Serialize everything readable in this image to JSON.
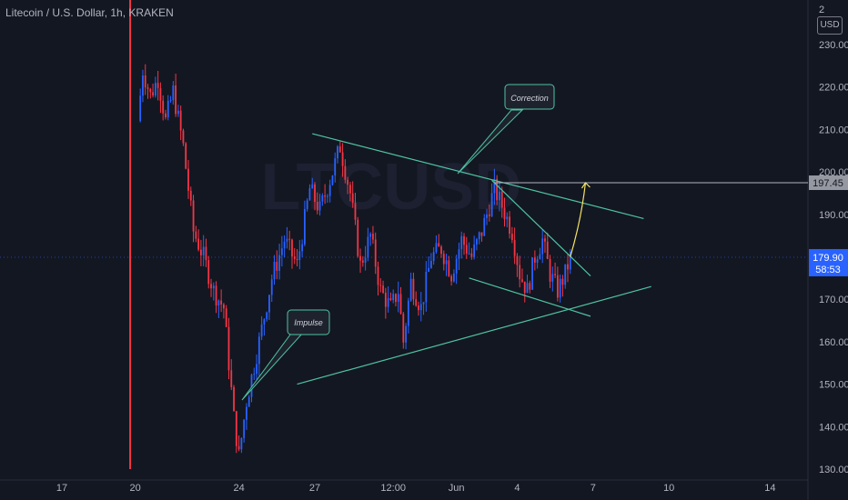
{
  "header": {
    "title": "Litecoin / U.S. Dollar, 1h, KRAKEN",
    "currency": "USD",
    "top_right_partial": "2"
  },
  "price_labels": {
    "target": "197.45",
    "current": "179.90",
    "countdown": "58:53"
  },
  "annotations": {
    "correction": "Correction",
    "impulse": "Impulse"
  },
  "colors": {
    "background": "#131722",
    "up": "#26a69a",
    "down": "#ef5350",
    "candle_blue": "#2962ff",
    "candle_red": "#f23645",
    "trendline": "#4fc3a1",
    "arrow": "#f7e463",
    "current_price_label": "#2962ff",
    "target_price_label": "#9598a1"
  },
  "chart_data": {
    "type": "candlestick",
    "title": "Litecoin / U.S. Dollar, 1h, KRAKEN",
    "ylabel": "USD",
    "y_ticks": [
      130,
      140,
      150,
      160,
      170,
      180,
      190,
      200,
      210,
      220,
      230
    ],
    "y_tick_labels": [
      "130.00",
      "140.00",
      "150.00",
      "160.00",
      "170.00",
      "180.00",
      "190.00",
      "200.00",
      "210.00",
      "220.00",
      "230.00"
    ],
    "ylim": [
      129,
      243
    ],
    "x_ticks": [
      "17",
      "20",
      "24",
      "27",
      "12:00",
      "Jun",
      "4",
      "7",
      "10",
      "14"
    ],
    "price_path": [
      {
        "x": 20.0,
        "p": 212
      },
      {
        "x": 20.2,
        "p": 224
      },
      {
        "x": 20.5,
        "p": 218
      },
      {
        "x": 20.8,
        "p": 222
      },
      {
        "x": 21.1,
        "p": 212
      },
      {
        "x": 21.4,
        "p": 219
      },
      {
        "x": 21.8,
        "p": 206
      },
      {
        "x": 22.2,
        "p": 186
      },
      {
        "x": 22.6,
        "p": 180
      },
      {
        "x": 23.0,
        "p": 172
      },
      {
        "x": 23.4,
        "p": 168
      },
      {
        "x": 23.8,
        "p": 142
      },
      {
        "x": 24.0,
        "p": 133
      },
      {
        "x": 24.3,
        "p": 146
      },
      {
        "x": 24.8,
        "p": 160
      },
      {
        "x": 25.3,
        "p": 175
      },
      {
        "x": 25.8,
        "p": 184
      },
      {
        "x": 26.3,
        "p": 178
      },
      {
        "x": 26.8,
        "p": 196
      },
      {
        "x": 27.2,
        "p": 191
      },
      {
        "x": 27.7,
        "p": 200
      },
      {
        "x": 28.0,
        "p": 206
      },
      {
        "x": 28.4,
        "p": 195
      },
      {
        "x": 28.8,
        "p": 178
      },
      {
        "x": 29.2,
        "p": 185
      },
      {
        "x": 29.6,
        "p": 172
      },
      {
        "x": 30.0,
        "p": 168
      },
      {
        "x": 30.3,
        "p": 172
      },
      {
        "x": 30.5,
        "p": 160
      },
      {
        "x": 30.8,
        "p": 174
      },
      {
        "x": 31.2,
        "p": 168
      },
      {
        "x": 31.6,
        "p": 180
      },
      {
        "x": 32.0,
        "p": 182
      },
      {
        "x": 32.4,
        "p": 176
      },
      {
        "x": 32.8,
        "p": 184
      },
      {
        "x": 33.2,
        "p": 180
      },
      {
        "x": 33.6,
        "p": 186
      },
      {
        "x": 34.1,
        "p": 196
      },
      {
        "x": 34.4,
        "p": 192
      },
      {
        "x": 34.8,
        "p": 186
      },
      {
        "x": 35.1,
        "p": 176
      },
      {
        "x": 35.4,
        "p": 172
      },
      {
        "x": 35.7,
        "p": 180
      },
      {
        "x": 36.0,
        "p": 184
      },
      {
        "x": 36.3,
        "p": 176
      },
      {
        "x": 36.6,
        "p": 172
      },
      {
        "x": 36.9,
        "p": 176
      },
      {
        "x": 37.1,
        "p": 179.9
      }
    ],
    "spike": {
      "x": 19.7,
      "high": 243,
      "low": 130
    },
    "current_price": 179.9,
    "target_price": 197.45,
    "trendlines": [
      {
        "from": [
          26.9,
          209
        ],
        "to": [
          40.0,
          189
        ]
      },
      {
        "from": [
          26.3,
          150
        ],
        "to": [
          40.3,
          173
        ]
      },
      {
        "from": [
          33.1,
          175
        ],
        "to": [
          37.9,
          166
        ]
      },
      {
        "from": [
          34.0,
          198
        ],
        "to": [
          37.9,
          175.5
        ]
      }
    ],
    "horizontal_lines": [
      {
        "from_x": 34.1,
        "price": 197.45
      }
    ],
    "arrow": {
      "from": [
        37.1,
        180
      ],
      "to": [
        37.7,
        197.45
      ]
    }
  }
}
